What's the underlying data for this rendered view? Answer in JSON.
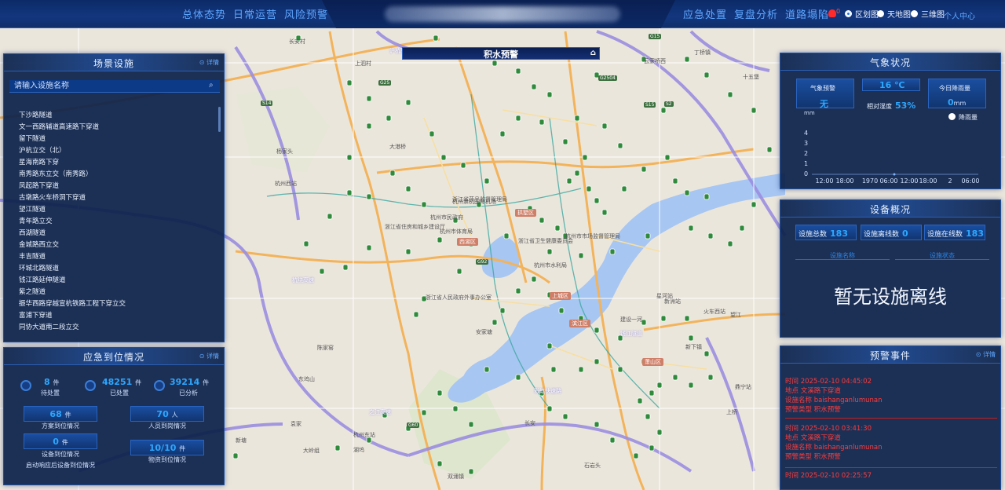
{
  "nav": {
    "left": [
      "总体态势",
      "日常运营",
      "风险预警"
    ],
    "right": [
      "应急处置",
      "复盘分析",
      "道路塌陷"
    ],
    "alarm_count": "0",
    "map_types": [
      {
        "label": "区划图",
        "selected": true
      },
      {
        "label": "天地图",
        "selected": false
      },
      {
        "label": "三维图",
        "selected": false
      }
    ],
    "user_label": "个人中心"
  },
  "map_title": "积水预警",
  "facilities": {
    "title": "场景设施",
    "detail": "详情",
    "search_placeholder": "请输入设施名称",
    "items": [
      "下沙路隧道",
      "文一西路辅道高速路下穿道",
      "留下隧道",
      "沪杭立交（北）",
      "星海南路下穿",
      "南秀路东立交（南秀路）",
      "凤起路下穿道",
      "古墩路火车桥洞下穿道",
      "望江隧道",
      "青年路立交",
      "西湖隧道",
      "金城路西立交",
      "丰吉隧道",
      "环城北路隧道",
      "钱江路延伸隧道",
      "紫之隧道",
      "振华西路穿越宣杭铁路工程下穿立交",
      "富浦下穿道",
      "同协大道南二段立交"
    ]
  },
  "emergency": {
    "title": "应急到位情况",
    "detail": "详情",
    "stats": [
      {
        "value": "8",
        "unit": "件",
        "label": "待处置"
      },
      {
        "value": "48251",
        "unit": "件",
        "label": "已处置"
      },
      {
        "value": "39214",
        "unit": "件",
        "label": "已分析"
      }
    ],
    "boxes": [
      {
        "value": "68",
        "unit": "件",
        "label": "方案到位情况"
      },
      {
        "value": "70",
        "unit": "人",
        "label": "人员到岗情况"
      },
      {
        "value": "0",
        "unit": "件",
        "label": "设备到位情况"
      },
      {
        "value": "10/10",
        "unit": "件",
        "label": "物资到位情况"
      }
    ],
    "extra_label": "启动响应后设备到位情况"
  },
  "weather": {
    "title": "气象状况",
    "warning_label": "气象预警",
    "warning_value": "无",
    "temperature": "16 ℃",
    "humidity_label": "相对湿度",
    "humidity_value": "53%",
    "rain_label": "今日降雨量",
    "rain_value": "0",
    "rain_unit": "mm",
    "legend_label": "降雨量",
    "y_unit": "mm",
    "y_ticks": [
      "4",
      "3",
      "2",
      "1",
      "0"
    ],
    "x_ticks": [
      "12:00",
      "18:00",
      "1970",
      "06:00",
      "12:00",
      "18:00",
      "2",
      "06:00"
    ]
  },
  "devices": {
    "title": "设备概况",
    "total_label": "设施总数",
    "total": "183",
    "offline_label": "设施离线数",
    "offline": "0",
    "online_label": "设施在线数",
    "online": "183",
    "tab_name": "设施名称",
    "tab_status": "设施状态",
    "empty_message": "暂无设施离线"
  },
  "warnings": {
    "title": "预警事件",
    "detail": "详情",
    "events": [
      {
        "time": "时间 2025-02-10 04:45:02",
        "location": "地点 文溪路下穿道",
        "facility": "设施名称 baishanganlumunan",
        "type": "预警类型 积水预警"
      },
      {
        "time": "时间 2025-02-10 03:41:30",
        "location": "地点 文溪路下穿道",
        "facility": "设施名称 baishanganlumunan",
        "type": "预警类型 积水预警"
      },
      {
        "time": "时间 2025-02-10 02:25:57",
        "location": "",
        "facility": "",
        "type": ""
      }
    ]
  },
  "map_labels": {
    "places": [
      "长安村",
      "上泗村",
      "丁桥镇",
      "云家桥西",
      "十五堡",
      "大港桥",
      "杨家头",
      "杭州西站",
      "浙江省药品监督管理局",
      "杭州市民政府",
      "浙江省住房和城乡建设厅",
      "杭州市体育局",
      "浙江省卫生健康委员会",
      "杭州市市场监督管理局",
      "杭州市水利局",
      "浙江省人民政府外事办公室",
      "安家塘",
      "陈家窑",
      "东坞山",
      "杭州东站",
      "新塘",
      "湖坞",
      "大岭组",
      "双涌镇",
      "长安",
      "石岩头",
      "新下镇",
      "上桥",
      "鼎宁站",
      "火车西站",
      "新洲站",
      "建设一河",
      "望江",
      "星河站",
      "袁家",
      "杭州余杭国际机场",
      "浙江大学"
    ],
    "districts": [
      "西湖区",
      "上城区",
      "滨江区",
      "萧山区",
      "拱墅区"
    ],
    "highways": [
      "G25",
      "S14",
      "G2504",
      "S2",
      "G60",
      "G92",
      "S15",
      "G15"
    ],
    "roads": [
      "杭绕高速",
      "沪杭高速",
      "彩虹快速路",
      "钱江隧道",
      "之江高速"
    ]
  }
}
